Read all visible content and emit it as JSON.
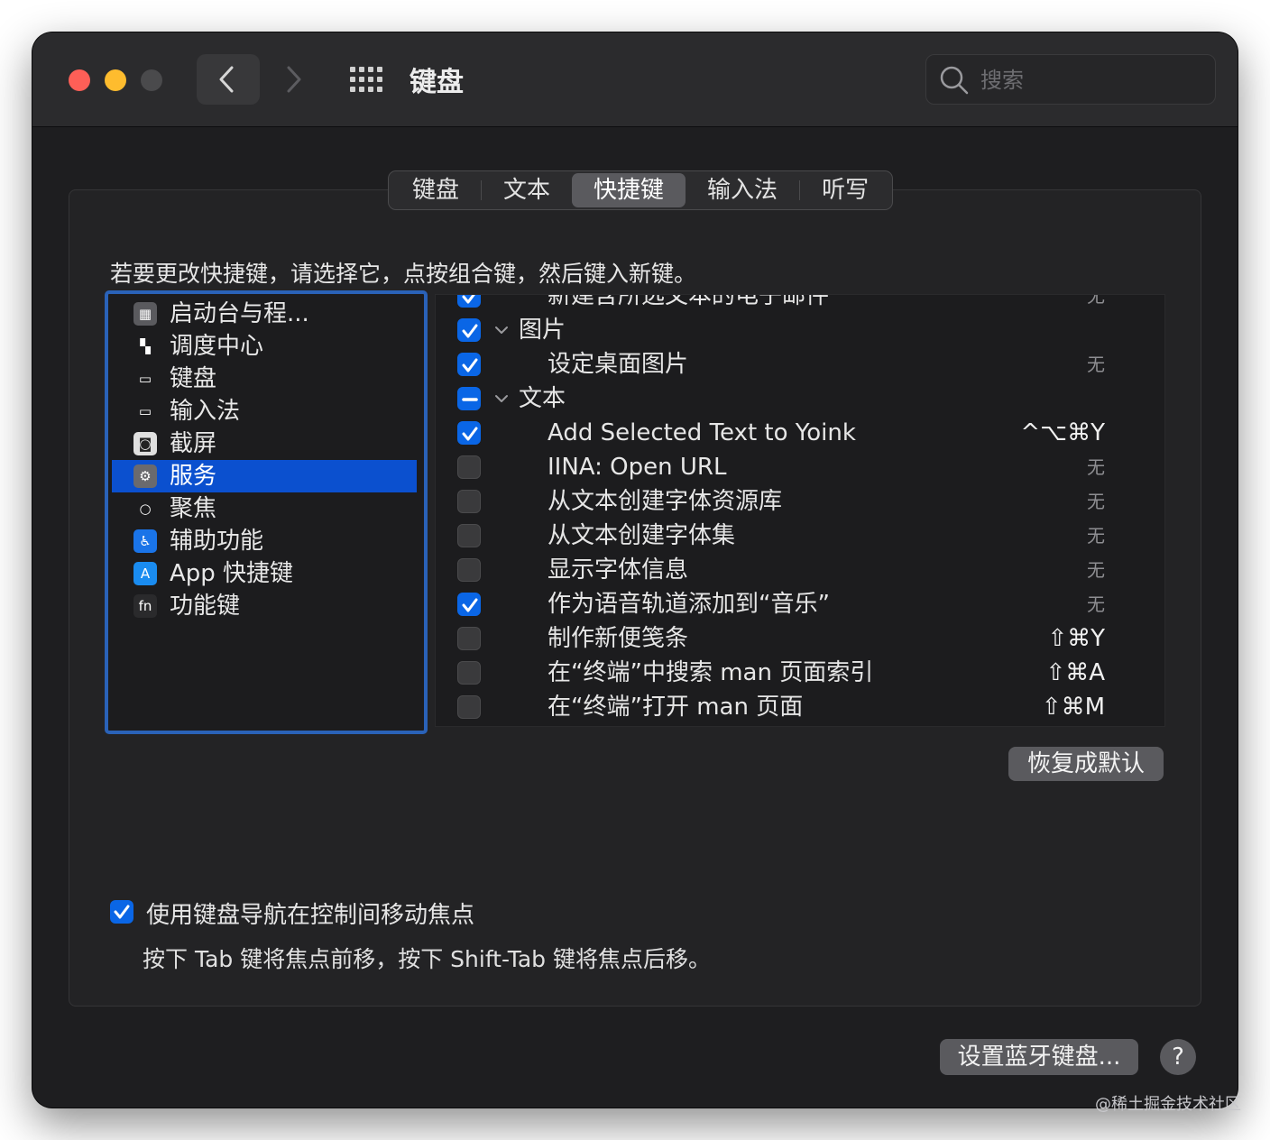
{
  "window": {
    "title": "键盘",
    "search_placeholder": "搜索"
  },
  "tabs": [
    {
      "label": "键盘",
      "active": false
    },
    {
      "label": "文本",
      "active": false
    },
    {
      "label": "快捷键",
      "active": true
    },
    {
      "label": "输入法",
      "active": false
    },
    {
      "label": "听写",
      "active": false
    }
  ],
  "instruction": "若要更改快捷键，请选择它，点按组合键，然后键入新键。",
  "categories": [
    {
      "label": "启动台与程...",
      "icon": "launchpad-icon"
    },
    {
      "label": "调度中心",
      "icon": "mission-control-icon"
    },
    {
      "label": "键盘",
      "icon": "keyboard-icon"
    },
    {
      "label": "输入法",
      "icon": "input-method-icon"
    },
    {
      "label": "截屏",
      "icon": "screenshot-icon"
    },
    {
      "label": "服务",
      "icon": "services-gear-icon",
      "selected": true
    },
    {
      "label": "聚焦",
      "icon": "spotlight-icon"
    },
    {
      "label": "辅助功能",
      "icon": "accessibility-icon"
    },
    {
      "label": "App 快捷键",
      "icon": "app-store-icon"
    },
    {
      "label": "功能键",
      "icon": "fn-key-icon"
    }
  ],
  "shortcuts": [
    {
      "type": "item",
      "label": "新建含所选文本的电子邮件",
      "key": "无",
      "state": "on",
      "partial": true
    },
    {
      "type": "group",
      "label": "图片",
      "state": "on"
    },
    {
      "type": "item",
      "label": "设定桌面图片",
      "key": "无",
      "state": "on"
    },
    {
      "type": "group",
      "label": "文本",
      "state": "mixed"
    },
    {
      "type": "item",
      "label": "Add Selected Text to Yoink",
      "key": "^⌥⌘Y",
      "state": "on"
    },
    {
      "type": "item",
      "label": "IINA: Open URL",
      "key": "无",
      "state": "off"
    },
    {
      "type": "item",
      "label": "从文本创建字体资源库",
      "key": "无",
      "state": "off"
    },
    {
      "type": "item",
      "label": "从文本创建字体集",
      "key": "无",
      "state": "off"
    },
    {
      "type": "item",
      "label": "显示字体信息",
      "key": "无",
      "state": "off"
    },
    {
      "type": "item",
      "label": "作为语音轨道添加到“音乐”",
      "key": "无",
      "state": "on"
    },
    {
      "type": "item",
      "label": "制作新便笺条",
      "key": "⇧⌘Y",
      "state": "off"
    },
    {
      "type": "item",
      "label": "在“终端”中搜索 man 页面索引",
      "key": "⇧⌘A",
      "state": "off"
    },
    {
      "type": "item",
      "label": "在“终端”打开 man 页面",
      "key": "⇧⌘M",
      "state": "off"
    }
  ],
  "restore_defaults_label": "恢复成默认",
  "keyboard_navigation": {
    "checked": true,
    "label": "使用键盘导航在控制间移动焦点",
    "hint": "按下 Tab 键将焦点前移，按下 Shift-Tab 键将焦点后移。"
  },
  "bluetooth_button_label": "设置蓝牙键盘...",
  "help_button_label": "?",
  "watermark": "@稀土掘金技术社区",
  "colors": {
    "accent": "#0a66e6",
    "selection": "#0b50cf",
    "window_bg": "#1e1e20"
  }
}
